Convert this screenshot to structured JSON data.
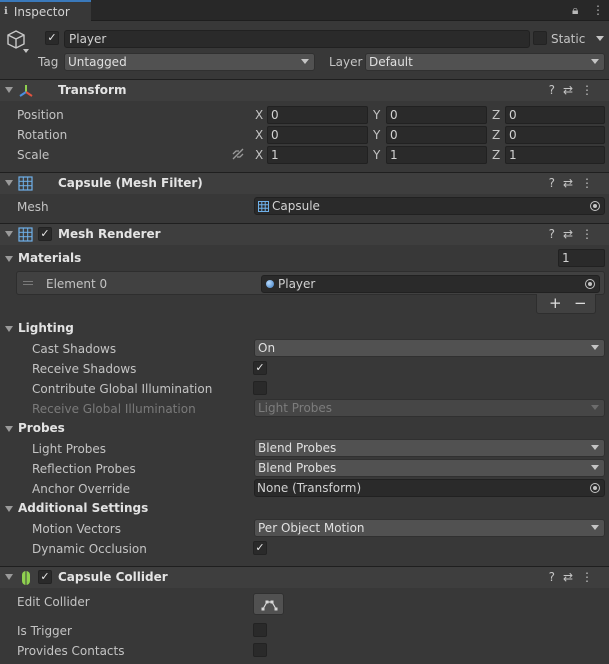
{
  "tab": {
    "title": "Inspector"
  },
  "object": {
    "name": "Player",
    "static_label": "Static",
    "tag_label": "Tag",
    "tag_value": "Untagged",
    "layer_label": "Layer",
    "layer_value": "Default"
  },
  "transform": {
    "title": "Transform",
    "rows": [
      {
        "label": "Position",
        "x": "0",
        "y": "0",
        "z": "0"
      },
      {
        "label": "Rotation",
        "x": "0",
        "y": "0",
        "z": "0"
      },
      {
        "label": "Scale",
        "x": "1",
        "y": "1",
        "z": "1"
      }
    ],
    "axis": {
      "x": "X",
      "y": "Y",
      "z": "Z"
    }
  },
  "mesh_filter": {
    "title": "Capsule (Mesh Filter)",
    "mesh_label": "Mesh",
    "mesh_value": "Capsule"
  },
  "mesh_renderer": {
    "title": "Mesh Renderer",
    "materials_label": "Materials",
    "materials_count": "1",
    "element_label": "Element 0",
    "element_value": "Player",
    "plus": "+",
    "minus": "−",
    "lighting": {
      "label": "Lighting",
      "cast_shadows_label": "Cast Shadows",
      "cast_shadows_value": "On",
      "receive_shadows_label": "Receive Shadows",
      "contribute_gi_label": "Contribute Global Illumination",
      "receive_gi_label": "Receive Global Illumination",
      "receive_gi_value": "Light Probes"
    },
    "probes": {
      "label": "Probes",
      "light_probes_label": "Light Probes",
      "light_probes_value": "Blend Probes",
      "reflection_probes_label": "Reflection Probes",
      "reflection_probes_value": "Blend Probes",
      "anchor_label": "Anchor Override",
      "anchor_value": "None (Transform)"
    },
    "additional": {
      "label": "Additional Settings",
      "motion_vectors_label": "Motion Vectors",
      "motion_vectors_value": "Per Object Motion",
      "dynamic_occlusion_label": "Dynamic Occlusion"
    }
  },
  "capsule_collider": {
    "title": "Capsule Collider",
    "edit_collider_label": "Edit Collider",
    "is_trigger_label": "Is Trigger",
    "provides_contacts_label": "Provides Contacts"
  },
  "tools": {
    "help": "?",
    "presets": "⇄",
    "menu": "⋮"
  },
  "check": "✓"
}
